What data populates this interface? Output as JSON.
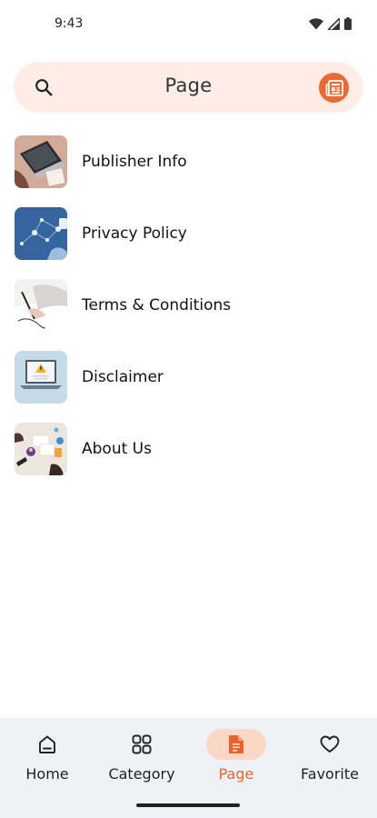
{
  "status_bar": {
    "time": "9:43",
    "icons": [
      "wifi-icon",
      "signal-icon",
      "battery-icon"
    ]
  },
  "header": {
    "title": "Page",
    "search_icon": "search-icon",
    "action_icon": "newspaper-icon",
    "accent_color": "#ec6a32",
    "pill_color": "#fdede6"
  },
  "pages": [
    {
      "label": "Publisher Info",
      "thumbnail": "laptop-desk-photo"
    },
    {
      "label": "Privacy Policy",
      "thumbnail": "network-lock-photo"
    },
    {
      "label": "Terms & Conditions",
      "thumbnail": "signing-document-photo"
    },
    {
      "label": "Disclaimer",
      "thumbnail": "laptop-warning-illustration"
    },
    {
      "label": "About Us",
      "thumbnail": "team-desk-illustration"
    }
  ],
  "bottom_nav": {
    "items": [
      {
        "label": "Home",
        "icon": "home-icon",
        "active": false
      },
      {
        "label": "Category",
        "icon": "grid-icon",
        "active": false
      },
      {
        "label": "Page",
        "icon": "document-icon",
        "active": true
      },
      {
        "label": "Favorite",
        "icon": "heart-icon",
        "active": false
      }
    ],
    "active_color": "#e9622b"
  }
}
